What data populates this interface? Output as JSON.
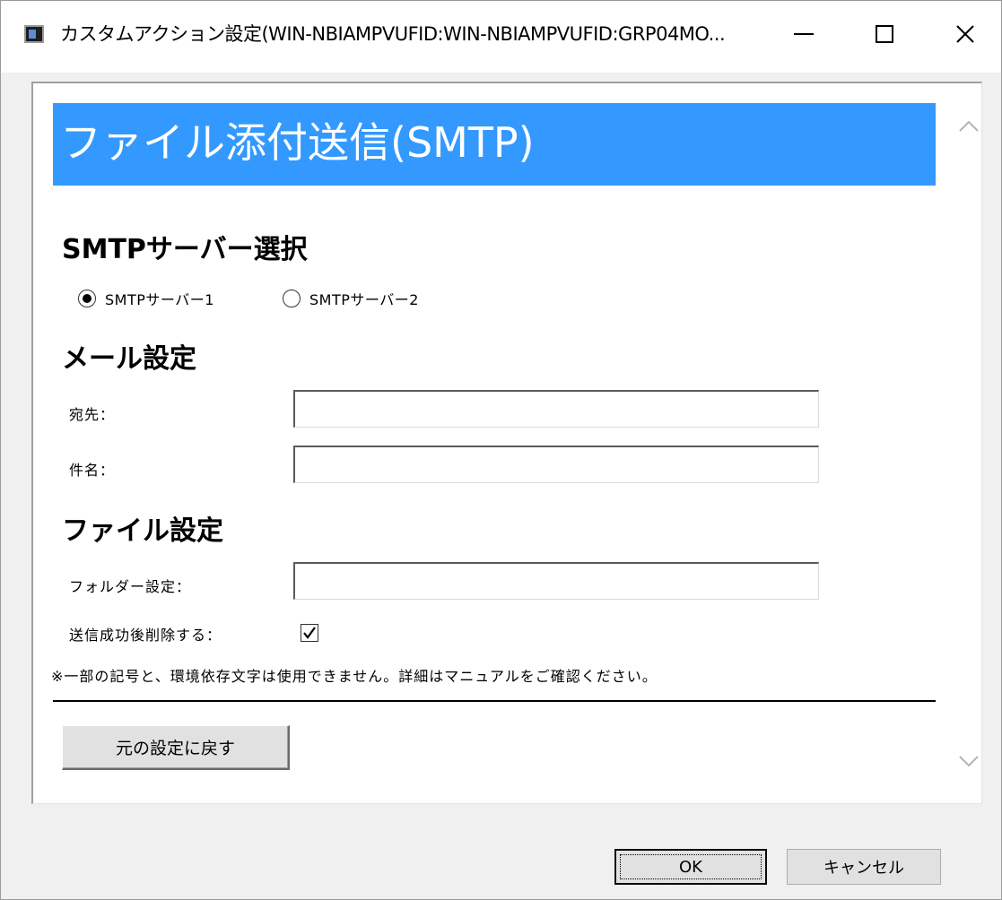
{
  "window": {
    "title": "カスタムアクション設定(WIN-NBIAMPVUFID:WIN-NBIAMPVUFID:GRP04MO..."
  },
  "header": {
    "title": "ファイル添付送信(SMTP)",
    "background": "#3399ff"
  },
  "smtp_section": {
    "title": "SMTPサーバー選択",
    "options": [
      {
        "label": "SMTPサーバー1",
        "selected": true
      },
      {
        "label": "SMTPサーバー2",
        "selected": false
      }
    ]
  },
  "mail_section": {
    "title": "メール設定",
    "to_label": "宛先：",
    "to_value": "",
    "subject_label": "件名：",
    "subject_value": ""
  },
  "file_section": {
    "title": "ファイル設定",
    "folder_label": "フォルダー設定：",
    "folder_value": "",
    "delete_label": "送信成功後削除する：",
    "delete_checked": true
  },
  "note": "※一部の記号と、環境依存文字は使用できません。詳細はマニュアルをご確認ください。",
  "buttons": {
    "reset": "元の設定に戻す",
    "ok": "OK",
    "cancel": "キャンセル"
  },
  "icons": {
    "window": "app-window-icon",
    "minimize": "minimize-icon",
    "maximize": "maximize-icon",
    "close": "close-icon",
    "scroll_up": "chevron-up-icon",
    "scroll_down": "chevron-down-icon",
    "check": "checkmark-icon"
  }
}
